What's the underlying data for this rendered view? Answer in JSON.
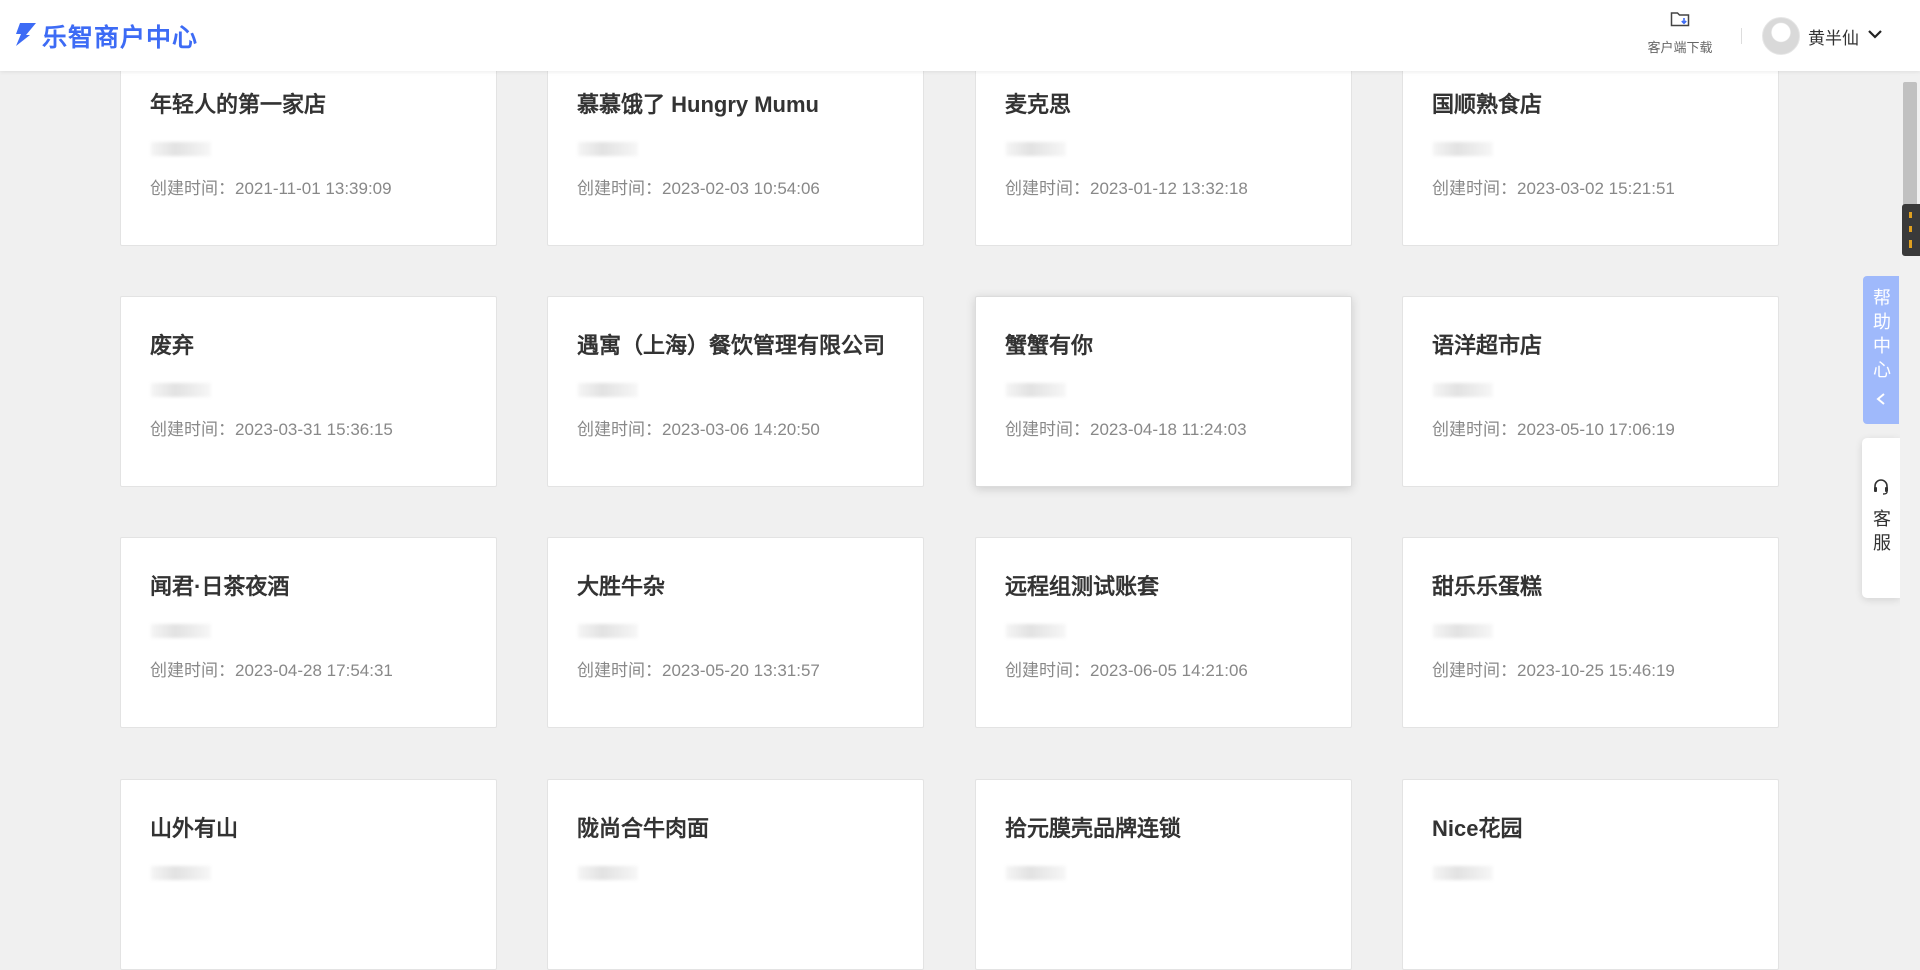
{
  "header": {
    "app_title": "乐智商户中心",
    "download_label": "客户端下载",
    "user_name": "黄半仙"
  },
  "stores": [
    {
      "name": "年轻人的第一家店",
      "time": "创建时间：2021-11-01 13:39:09"
    },
    {
      "name": "慕慕饿了 Hungry Mumu",
      "time": "创建时间：2023-02-03 10:54:06"
    },
    {
      "name": "麦克思",
      "time": "创建时间：2023-01-12 13:32:18"
    },
    {
      "name": "国顺熟食店",
      "time": "创建时间：2023-03-02 15:21:51"
    },
    {
      "name": "废弃",
      "time": "创建时间：2023-03-31 15:36:15"
    },
    {
      "name": "遇寓（上海）餐饮管理有限公司",
      "time": "创建时间：2023-03-06 14:20:50"
    },
    {
      "name": "蟹蟹有你",
      "time": "创建时间：2023-04-18 11:24:03"
    },
    {
      "name": "语洋超市店",
      "time": "创建时间：2023-05-10 17:06:19"
    },
    {
      "name": "闻君·日茶夜酒",
      "time": "创建时间：2023-04-28 17:54:31"
    },
    {
      "name": "大胜牛杂",
      "time": "创建时间：2023-05-20 13:31:57"
    },
    {
      "name": "远程组测试账套",
      "time": "创建时间：2023-06-05 14:21:06"
    },
    {
      "name": "甜乐乐蛋糕",
      "time": "创建时间：2023-10-25 15:46:19"
    },
    {
      "name": "山外有山",
      "time": ""
    },
    {
      "name": "陇尚合牛肉面",
      "time": ""
    },
    {
      "name": "拾元膜壳品牌连锁",
      "time": ""
    },
    {
      "name": "Nice花园",
      "time": ""
    }
  ],
  "sidebar": {
    "help_label": "帮助中心",
    "service_label": "客服"
  },
  "colors": {
    "brand": "#3d6bf5",
    "help_tab": "#9fb9fb"
  }
}
